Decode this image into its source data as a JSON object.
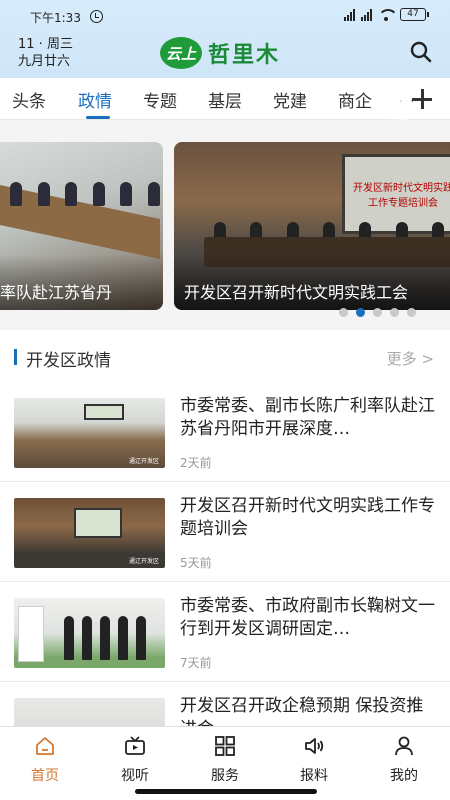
{
  "status": {
    "time": "下午1:33",
    "battery": "47"
  },
  "header": {
    "date_line1": "11 · 周三",
    "date_line2": "九月廿六",
    "logo_mark": "云上",
    "logo_text": "哲里木"
  },
  "tabs": [
    "头条",
    "政情",
    "专题",
    "基层",
    "党建",
    "商企",
    "…"
  ],
  "active_tab": "政情",
  "carousel": {
    "slides": [
      {
        "caption": "率队赴江苏省丹",
        "screen_text": ""
      },
      {
        "caption": "开发区召开新时代文明实践工会",
        "screen_text": "开发区新时代文明实践工作专题培训会"
      }
    ],
    "active_index": 1,
    "dot_count": 5
  },
  "section": {
    "title": "开发区政情",
    "more": "更多 >"
  },
  "news": [
    {
      "title": "市委常委、副市长陈广利率队赴江苏省丹阳市开展深度…",
      "time": "2天前",
      "thumb_watermark": "通辽开发区"
    },
    {
      "title": "开发区召开新时代文明实践工作专题培训会",
      "time": "5天前",
      "thumb_watermark": "通辽开发区"
    },
    {
      "title": "市委常委、市政府副市长鞠树文一行到开发区调研固定…",
      "time": "7天前",
      "thumb_watermark": ""
    },
    {
      "title": "开发区召开政企稳预期 保投资推进会",
      "time": "",
      "thumb_watermark": ""
    }
  ],
  "bottom_nav": [
    {
      "label": "首页",
      "icon": "home-icon"
    },
    {
      "label": "视听",
      "icon": "video-icon"
    },
    {
      "label": "服务",
      "icon": "grid-icon"
    },
    {
      "label": "报料",
      "icon": "speaker-icon"
    },
    {
      "label": "我的",
      "icon": "user-icon"
    }
  ],
  "active_nav": "首页",
  "colors": {
    "accent": "#1b6fbf",
    "nav_active": "#d4772e",
    "logo_green": "#1a8a36"
  }
}
